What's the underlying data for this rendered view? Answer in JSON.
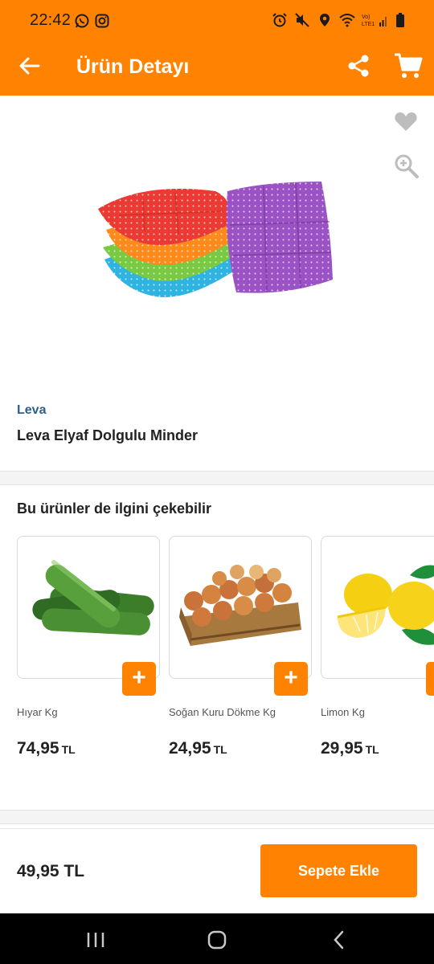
{
  "status_bar": {
    "time": "22:42",
    "left_icons": [
      "whatsapp-icon",
      "instagram-icon"
    ],
    "right_icons": [
      "alarm-icon",
      "mute-icon",
      "location-icon",
      "wifi-icon",
      "volte-signal-icon",
      "battery-icon"
    ]
  },
  "app_bar": {
    "title": "Ürün Detayı",
    "icons": [
      "back-arrow-icon",
      "share-icon",
      "cart-icon"
    ]
  },
  "product": {
    "brand": "Leva",
    "name": "Leva Elyaf Dolgulu Minder",
    "image": "colorful-seat-cushions",
    "favorite_icon": "heart-icon",
    "zoom_icon": "zoom-in-icon"
  },
  "recommendations": {
    "title": "Bu ürünler de ilgini çekebilir",
    "items": [
      {
        "name": "Hıyar Kg",
        "price": "74,95",
        "currency": "TL",
        "image": "cucumbers"
      },
      {
        "name": "Soğan Kuru Dökme Kg",
        "price": "24,95",
        "currency": "TL",
        "image": "onions-crate"
      },
      {
        "name": "Limon Kg",
        "price": "29,95",
        "currency": "TL",
        "image": "lemons"
      }
    ],
    "add_symbol": "+"
  },
  "bottom_bar": {
    "price": "49,95 TL",
    "button_label": "Sepete Ekle"
  },
  "colors": {
    "accent": "#ff8200",
    "brand_text": "#2d5f8c"
  }
}
